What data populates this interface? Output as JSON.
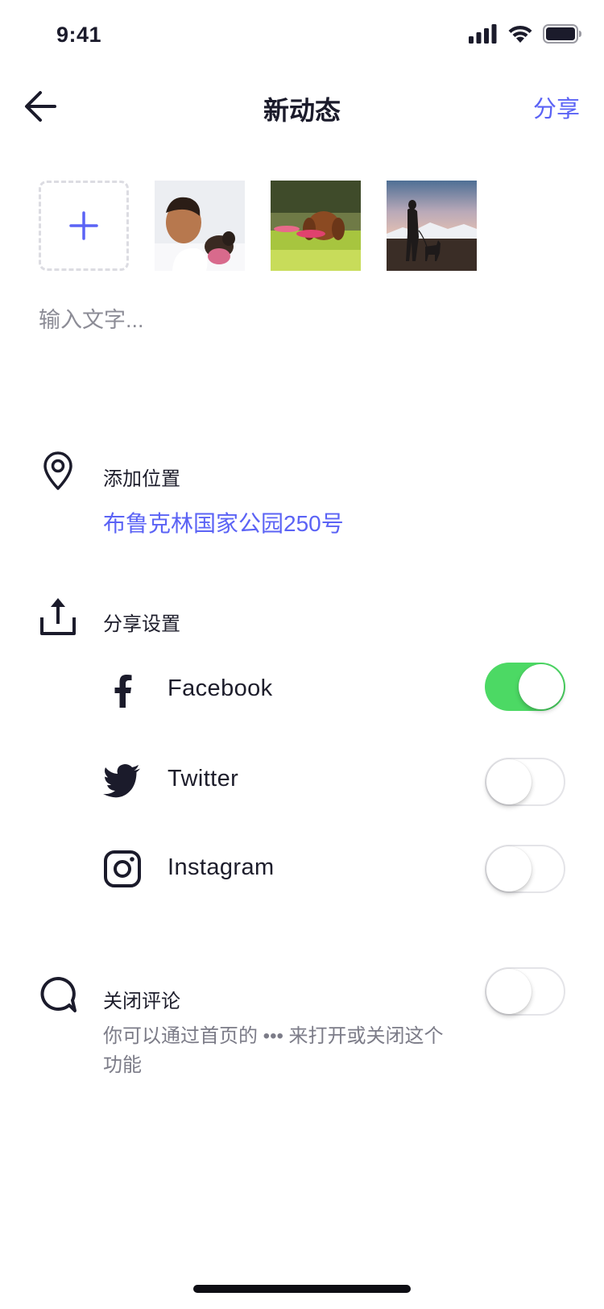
{
  "status_bar": {
    "time": "9:41"
  },
  "nav": {
    "title": "新动态",
    "share_label": "分享"
  },
  "photos": {
    "add_icon": "plus-icon",
    "items": [
      "photo-kid-with-puppy",
      "photo-puppy-in-grass",
      "photo-person-with-dog-at-sunset"
    ]
  },
  "composer": {
    "placeholder": "输入文字..."
  },
  "location": {
    "icon": "location-pin-icon",
    "label": "添加位置",
    "value": "布鲁克林国家公园250号"
  },
  "share_settings": {
    "icon": "share-upload-icon",
    "label": "分享设置",
    "platforms": [
      {
        "name": "Facebook",
        "icon": "facebook-icon",
        "enabled": true
      },
      {
        "name": "Twitter",
        "icon": "twitter-icon",
        "enabled": false
      },
      {
        "name": "Instagram",
        "icon": "instagram-icon",
        "enabled": false
      }
    ]
  },
  "comments": {
    "icon": "comment-bubble-icon",
    "label": "关闭评论",
    "enabled": false,
    "description": "你可以通过首页的 ••• 来打开或关闭这个功能"
  },
  "colors": {
    "accent": "#5b63f5",
    "toggle_on": "#4cd964",
    "text_primary": "#1d1d2b",
    "text_secondary": "#7c7c88"
  }
}
